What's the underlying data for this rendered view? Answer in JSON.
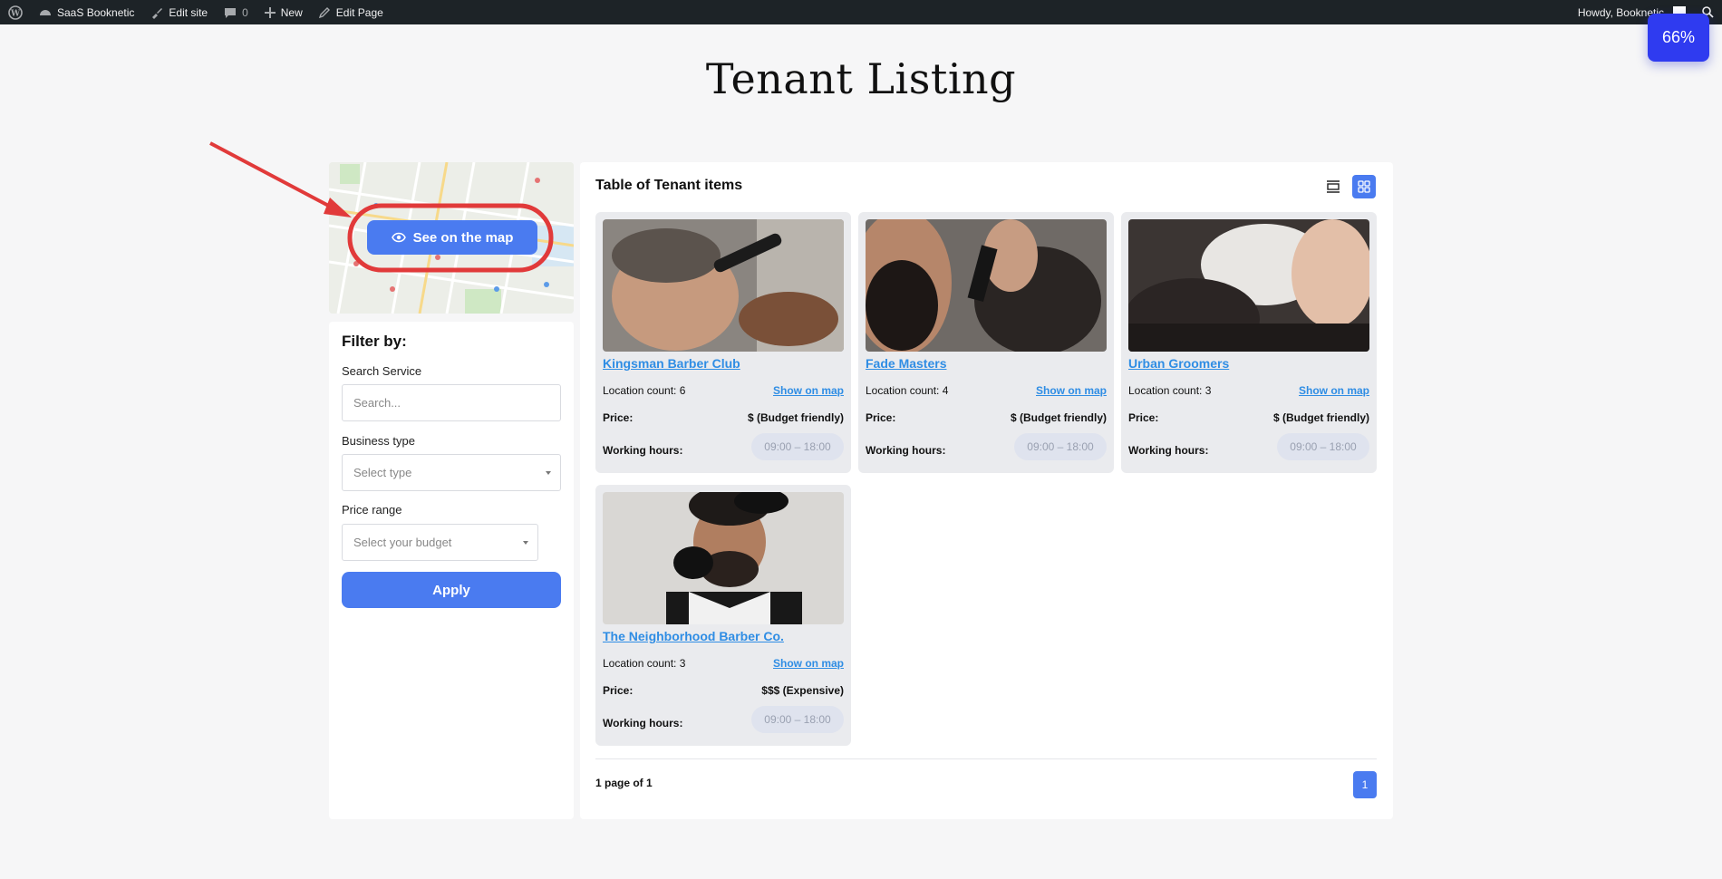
{
  "admin_bar": {
    "site_name": "SaaS Booknetic",
    "edit_site": "Edit site",
    "comments_count": "0",
    "new_label": "New",
    "edit_page": "Edit Page",
    "greeting": "Howdy, Booknetic"
  },
  "zoom": "66%",
  "page_title": "Tenant Listing",
  "sidebar": {
    "see_on_map": "See on the map",
    "filter_title": "Filter by:",
    "search_service_label": "Search Service",
    "search_placeholder": "Search...",
    "business_type_label": "Business type",
    "business_type_value": "Select type",
    "price_range_label": "Price range",
    "price_range_value": "Select your budget",
    "apply_label": "Apply"
  },
  "main": {
    "title": "Table of Tenant items",
    "pagination_info": "1 page of 1",
    "current_page": "1",
    "tenants": [
      {
        "name": "Kingsman Barber Club",
        "location_count": "Location count: 6",
        "show_on_map": "Show on map",
        "price_label": "Price:",
        "price": "$ (Budget friendly)",
        "hours_label": "Working hours:",
        "hours": "09:00 – 18:00"
      },
      {
        "name": "Fade Masters",
        "location_count": "Location count: 4",
        "show_on_map": "Show on map",
        "price_label": "Price:",
        "price": "$ (Budget friendly)",
        "hours_label": "Working hours:",
        "hours": "09:00 – 18:00"
      },
      {
        "name": "Urban Groomers",
        "location_count": "Location count: 3",
        "show_on_map": "Show on map",
        "price_label": "Price:",
        "price": "$ (Budget friendly)",
        "hours_label": "Working hours:",
        "hours": "09:00 – 18:00"
      },
      {
        "name": "The Neighborhood Barber Co.",
        "location_count": "Location count: 3",
        "show_on_map": "Show on map",
        "price_label": "Price:",
        "price": "$$$ (Expensive)",
        "hours_label": "Working hours:",
        "hours": "09:00 – 18:00"
      }
    ]
  }
}
